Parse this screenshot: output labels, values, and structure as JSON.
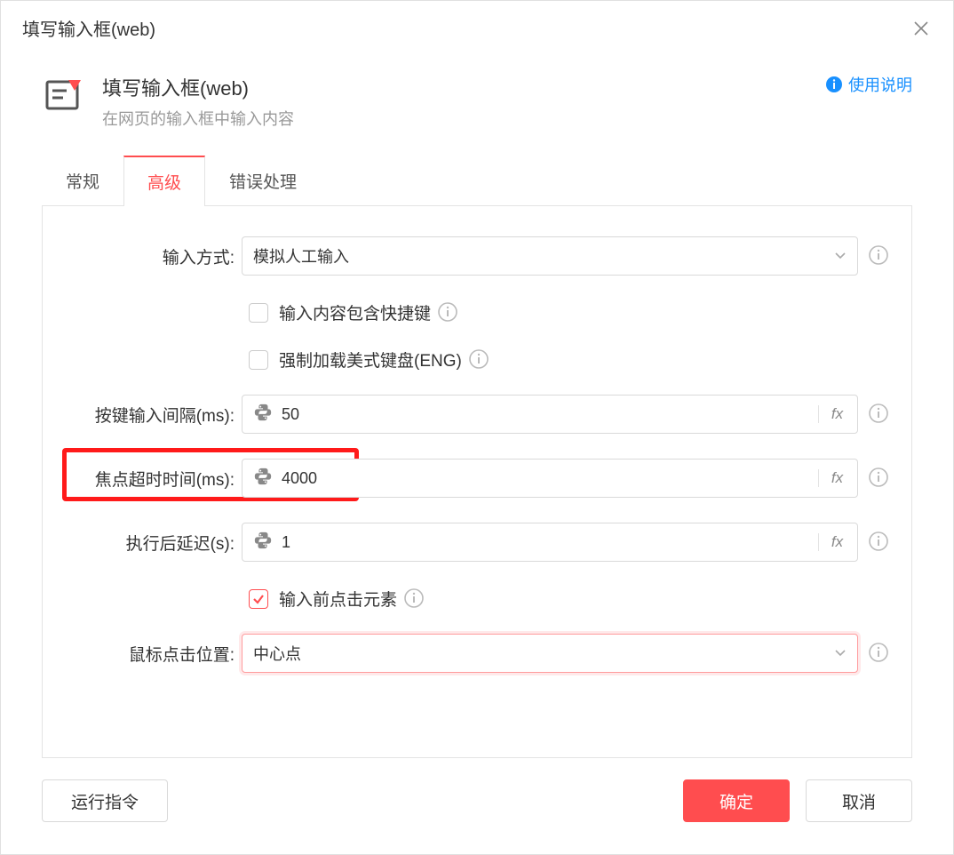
{
  "titlebar": {
    "title": "填写输入框(web)"
  },
  "header": {
    "title": "填写输入框(web)",
    "subtitle": "在网页的输入框中输入内容",
    "help": "使用说明"
  },
  "tabs": {
    "general": "常规",
    "advanced": "高级",
    "error": "错误处理"
  },
  "form": {
    "input_method_label": "输入方式:",
    "input_method_value": "模拟人工输入",
    "hotkey_checkbox": "输入内容包含快捷键",
    "eng_keyboard_checkbox": "强制加载美式键盘(ENG)",
    "key_interval_label": "按键输入间隔(ms):",
    "key_interval_value": "50",
    "focus_timeout_label": "焦点超时时间(ms):",
    "focus_timeout_value": "4000",
    "exec_delay_label": "执行后延迟(s):",
    "exec_delay_value": "1",
    "click_before_checkbox": "输入前点击元素",
    "click_position_label": "鼠标点击位置:",
    "click_position_value": "中心点",
    "fx": "fx"
  },
  "footer": {
    "run": "运行指令",
    "ok": "确定",
    "cancel": "取消"
  }
}
